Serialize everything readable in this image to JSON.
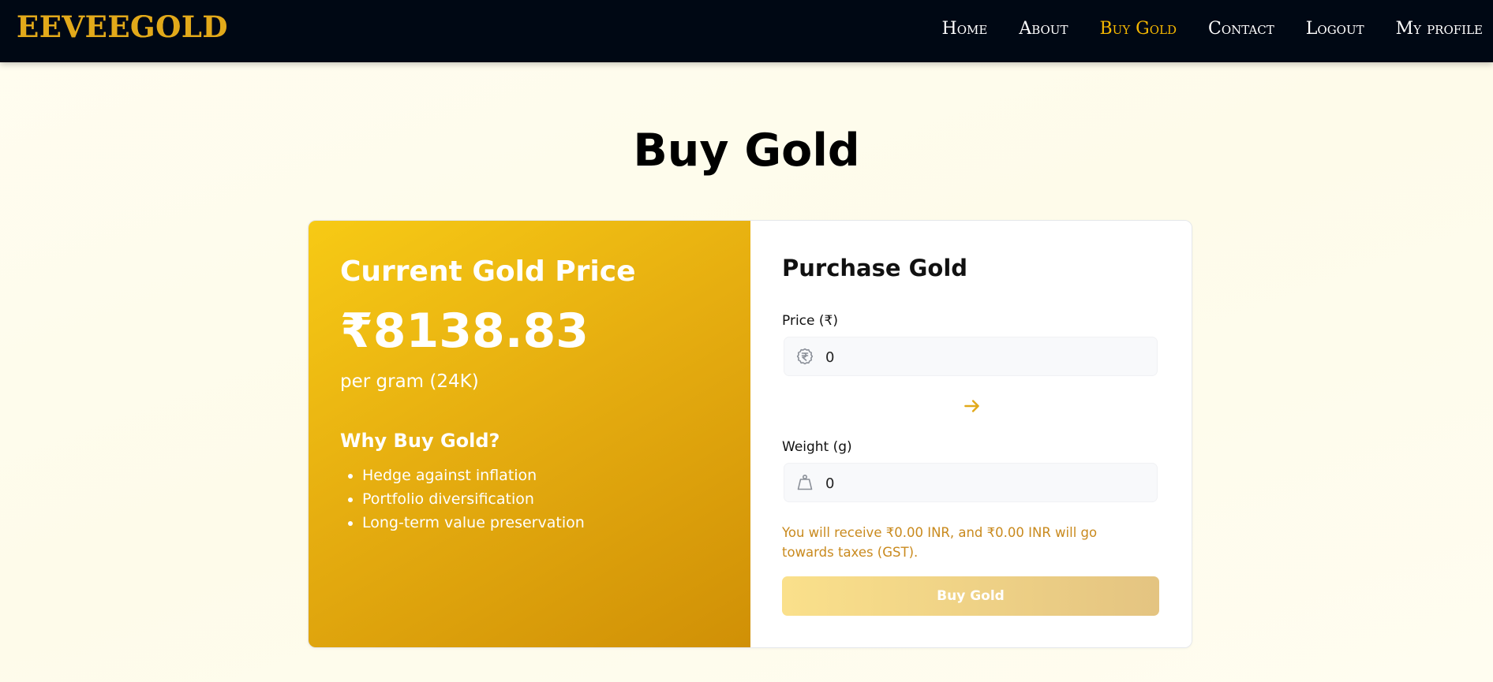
{
  "navbar": {
    "brand": "EEVEEGOLD",
    "links": [
      {
        "label": "Home",
        "active": false
      },
      {
        "label": "About",
        "active": false
      },
      {
        "label": "Buy Gold",
        "active": true
      },
      {
        "label": "Contact",
        "active": false
      },
      {
        "label": "Logout",
        "active": false
      },
      {
        "label": "My profile",
        "active": false
      }
    ]
  },
  "page": {
    "title": "Buy Gold"
  },
  "price_panel": {
    "heading": "Current Gold Price",
    "price": "₹8138.83",
    "unit": "per gram (24K)",
    "why_heading": "Why Buy Gold?",
    "reasons": [
      "Hedge against inflation",
      "Portfolio diversification",
      "Long-term value preservation"
    ]
  },
  "purchase_form": {
    "heading": "Purchase Gold",
    "price_label": "Price (₹)",
    "price_value": "0",
    "price_icon": "rupee-coin-icon",
    "swap_icon": "arrow-right-icon",
    "weight_label": "Weight (g)",
    "weight_value": "0",
    "weight_icon": "weight-bag-icon",
    "summary": "You will receive ₹0.00 INR, and ₹0.00 INR will go towards taxes (GST).",
    "buy_label": "Buy Gold"
  },
  "colors": {
    "navbar_bg": "#000814",
    "accent": "#f5b800",
    "summary_text": "#c98a1e"
  }
}
